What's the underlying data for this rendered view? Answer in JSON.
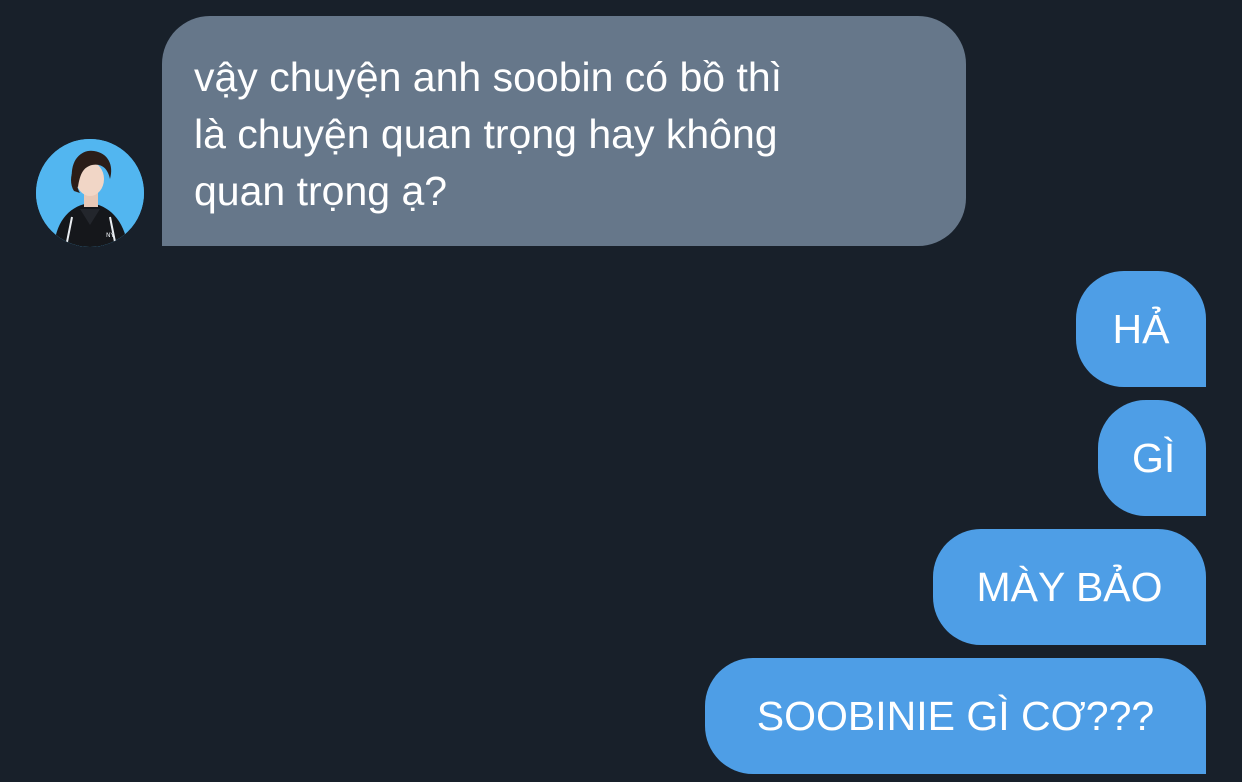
{
  "conversation": {
    "incoming_message": {
      "lines": [
        "vậy chuyện anh soobin có bồ thì",
        "là chuyện quan trọng hay không",
        "quan trọng ạ?"
      ],
      "bubble_color": "#66778a"
    },
    "outgoing_messages": [
      "HẢ",
      "GÌ",
      "MÀY BẢO",
      "SOOBINIE GÌ CƠ???"
    ],
    "outgoing_bubble_color": "#4e9ee6",
    "background_color": "#18202a",
    "avatar": {
      "background_color": "#52b6f0",
      "description_icon": "person-avatar-icon"
    }
  }
}
